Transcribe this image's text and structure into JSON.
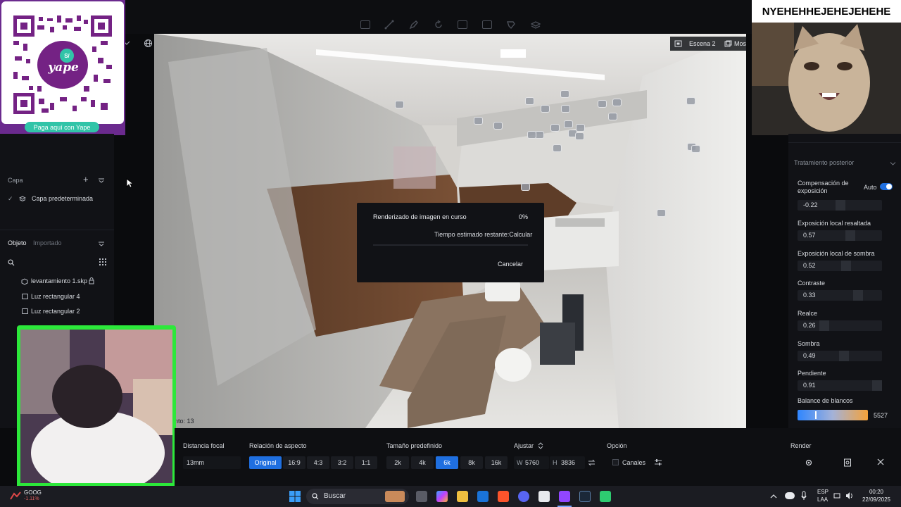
{
  "qr": {
    "caption": "Paga aquí con Yape",
    "brand": "yape",
    "badge": "S/",
    "colors": {
      "frame": "#6b2a8e",
      "caption_bg": "#31c4a8",
      "purple": "#742284"
    }
  },
  "scene": {
    "scene_name": "Escena 2",
    "show_label": "Mostra"
  },
  "layers": {
    "title": "Capa",
    "items": [
      {
        "label": "Capa predeterminada",
        "checked": true
      }
    ]
  },
  "objects": {
    "tabs": [
      {
        "label": "Objeto",
        "active": true
      },
      {
        "label": "Importado",
        "active": false
      }
    ],
    "items": [
      {
        "label": "levantamiento 1.skp",
        "locked": true
      },
      {
        "label": "Luz rectangular 4",
        "locked": false
      },
      {
        "label": "Luz rectangular 2",
        "locked": false
      }
    ]
  },
  "viewport": {
    "partial_text": "nto: 13"
  },
  "render_dialog": {
    "title": "Renderizado de imagen en curso",
    "progress_label": "0%",
    "progress": 0,
    "eta_label": "Tiempo estimado restante:",
    "eta_value": "Calcular",
    "cancel_label": "Cancelar"
  },
  "webcam_overlay": {
    "caption": "NYEHEHHEJEHEJEHEHE"
  },
  "post": {
    "title": "Tratamiento posterior",
    "exposure_comp": {
      "label": "Compensación de exposición",
      "auto_label": "Auto",
      "auto_on": true,
      "value": "-0.22",
      "level": 0.45
    },
    "sliders": [
      {
        "label": "Exposición local resaltada",
        "value": "0.57",
        "level": 0.57
      },
      {
        "label": "Exposición local de sombra",
        "value": "0.52",
        "level": 0.52
      },
      {
        "label": "Contraste",
        "value": "0.33",
        "level": 0.66
      },
      {
        "label": "Realce",
        "value": "0.26",
        "level": 0.26
      },
      {
        "label": "Sombra",
        "value": "0.49",
        "level": 0.49
      },
      {
        "label": "Pendiente",
        "value": "0.91",
        "level": 0.91
      }
    ],
    "white_balance": {
      "label": "Balance de blancos",
      "value": "5527",
      "level": 0.25
    }
  },
  "bottom": {
    "focal": {
      "label": "Distancia focal",
      "value": "13mm"
    },
    "aspect": {
      "label": "Relación de aspecto",
      "options": [
        "Original",
        "16:9",
        "4:3",
        "3:2",
        "1:1"
      ],
      "selected": "Original"
    },
    "preset": {
      "label": "Tamaño predefinido",
      "options": [
        "2k",
        "4k",
        "6k",
        "8k",
        "16k"
      ],
      "selected": "6k"
    },
    "adjust": {
      "label": "Ajustar",
      "w_label": "W",
      "w_value": "5760",
      "h_label": "H",
      "h_value": "3836"
    },
    "option": {
      "label": "Opción",
      "channels_label": "Canales"
    },
    "render": {
      "label": "Render"
    }
  },
  "taskbar": {
    "stock": {
      "symbol": "GOOG",
      "change": "-1.11%"
    },
    "search_placeholder": "Buscar",
    "lang": {
      "code": "ESP",
      "layout": "LAA"
    },
    "time": "00:20",
    "date": "22/09/2025"
  }
}
